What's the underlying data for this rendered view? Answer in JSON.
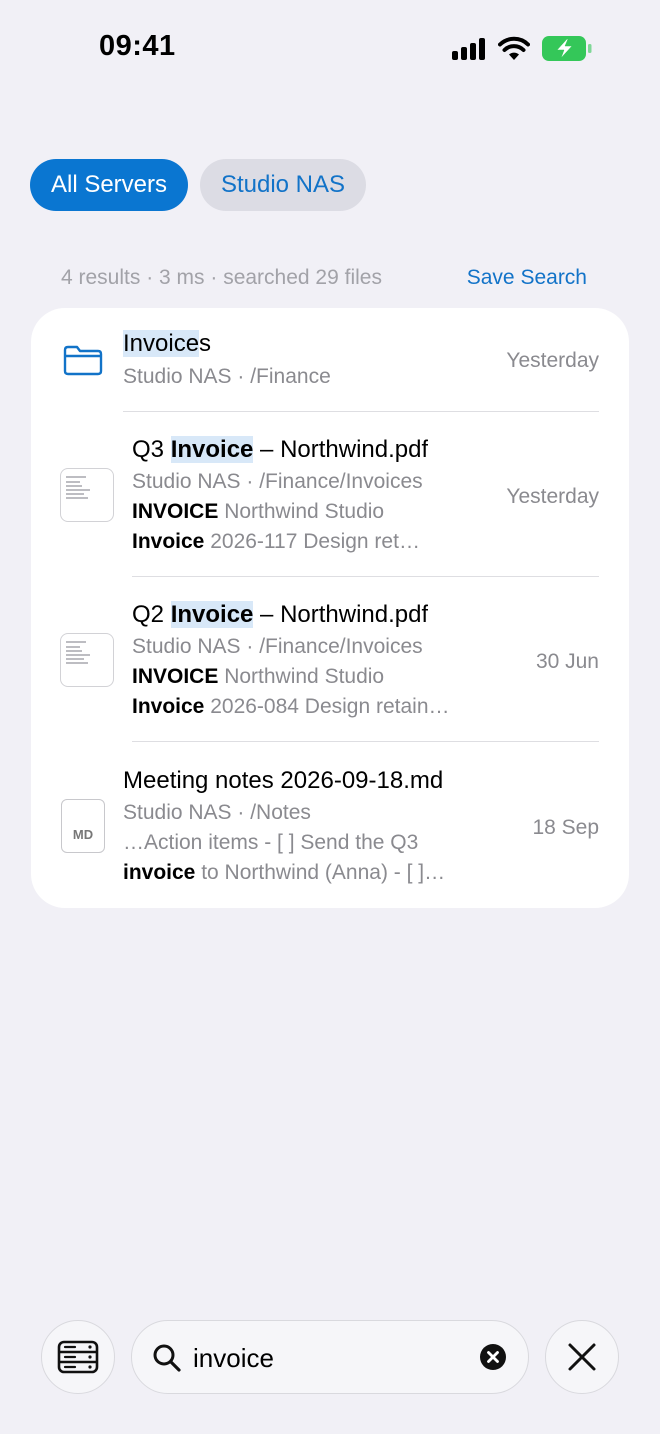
{
  "status": {
    "time": "09:41"
  },
  "filters": [
    {
      "label": "All Servers",
      "selected": true
    },
    {
      "label": "Studio NAS",
      "selected": false
    }
  ],
  "results_summary": "4 results · 3 ms · searched 29 files",
  "save_search_label": "Save Search",
  "results": [
    {
      "kind": "folder",
      "icon": "folder-icon",
      "title_match": "Invoice",
      "title_rest": "s",
      "location": "Studio NAS · /Finance",
      "date": "Yesterday"
    },
    {
      "kind": "pdf",
      "icon": "pdf-thumbnail",
      "title_pre": "Q3 ",
      "title_match": "Invoice",
      "title_post": " – Northwind.pdf",
      "location": "Studio NAS · /Finance/Invoices",
      "snippet1_bold": "INVOICE",
      "snippet1_rest": " Northwind Studio",
      "snippet2_bold": "Invoice",
      "snippet2_rest": " 2026-117 Design ret…",
      "date": "Yesterday"
    },
    {
      "kind": "pdf",
      "icon": "pdf-thumbnail",
      "title_pre": "Q2 ",
      "title_match": "Invoice",
      "title_post": " – Northwind.pdf",
      "location": "Studio NAS · /Finance/Invoices",
      "snippet1_bold": "INVOICE",
      "snippet1_rest": " Northwind Studio",
      "snippet2_bold": "Invoice",
      "snippet2_rest": " 2026-084 Design retain…",
      "date": "30 Jun"
    },
    {
      "kind": "markdown",
      "icon": "md-file-icon",
      "icon_text": "MD",
      "title": "Meeting notes 2026-09-18.md",
      "location": "Studio NAS · /Notes",
      "snippet1": "…Action items - [ ] Send the Q3",
      "snippet2_bold": "invoice",
      "snippet2_rest": " to Northwind (Anna) - [ ]…",
      "date": "18 Sep"
    }
  ],
  "toolbar": {
    "search_value": "invoice",
    "servers_icon": "servers-icon",
    "close_icon": "close-icon"
  },
  "colors": {
    "accent": "#0a76d1",
    "background": "#f1f0f6",
    "highlight": "#d8e8f8"
  }
}
